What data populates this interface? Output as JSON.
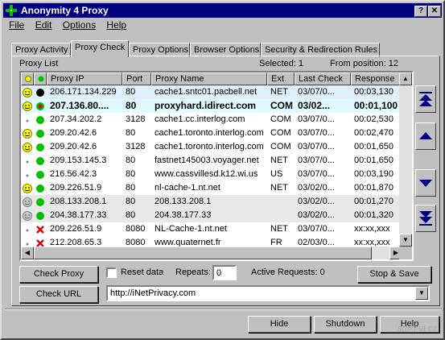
{
  "window": {
    "title": "Anonymity 4 Proxy"
  },
  "menu": [
    "File",
    "Edit",
    "Options",
    "Help"
  ],
  "tabs": [
    "Proxy Activity",
    "Proxy Check",
    "Proxy Options",
    "Browser Options",
    "Security & Redirection Rules"
  ],
  "active_tab": "Proxy Check",
  "list": {
    "label": "Proxy List",
    "selected_text": "Selected: 1",
    "from_position_text": "From position: 12",
    "columns": [
      "Proxy IP",
      "Port",
      "Proxy Name",
      "Ext.",
      "Last Check",
      "Response"
    ],
    "rows": [
      {
        "status": "smile",
        "dot": "black",
        "ip": "206.171.134.229",
        "port": "80",
        "name": "cache1.sntc01.pacbell.net",
        "ext": "NET",
        "last_check": "03/07/0...",
        "response": "00:03,130",
        "style": "sel"
      },
      {
        "status": "smile",
        "dot": "green-red",
        "ip": "207.136.80....",
        "port": "80",
        "name": "proxyhard.idirect.com",
        "ext": "COM",
        "last_check": "03/02...",
        "response": "00:01,100",
        "style": "bold"
      },
      {
        "status": "small",
        "dot": "green",
        "ip": "207.34.202.2",
        "port": "3128",
        "name": "cache1.cc.interlog.com",
        "ext": "COM",
        "last_check": "03/07/0...",
        "response": "00:02,530",
        "style": ""
      },
      {
        "status": "smile",
        "dot": "green",
        "ip": "209.20.42.6",
        "port": "80",
        "name": "cache1.toronto.interlog.com",
        "ext": "COM",
        "last_check": "03/07/0...",
        "response": "00:02,470",
        "style": ""
      },
      {
        "status": "smile",
        "dot": "green",
        "ip": "209.20.42.6",
        "port": "3128",
        "name": "cache1.toronto.interlog.com",
        "ext": "COM",
        "last_check": "03/07/0...",
        "response": "00:01,650",
        "style": ""
      },
      {
        "status": "small",
        "dot": "green",
        "ip": "209.153.145.3",
        "port": "80",
        "name": "fastnet145003.voyager.net",
        "ext": "NET",
        "last_check": "03/07/0...",
        "response": "00:01,650",
        "style": ""
      },
      {
        "status": "small",
        "dot": "green",
        "ip": "216.56.42.3",
        "port": "80",
        "name": "www.cassvillesd.k12.wi.us",
        "ext": "US",
        "last_check": "03/07/0...",
        "response": "00:03,190",
        "style": ""
      },
      {
        "status": "smile",
        "dot": "green",
        "ip": "209.226.51.9",
        "port": "80",
        "name": "nl-cache-1.nt.net",
        "ext": "NET",
        "last_check": "03/02/0...",
        "response": "00:01,870",
        "style": ""
      },
      {
        "status": "grey",
        "dot": "green",
        "ip": "208.133.208.1",
        "port": "80",
        "name": "208.133.208.1",
        "ext": "",
        "last_check": "03/02/0...",
        "response": "00:01,270",
        "style": "grey"
      },
      {
        "status": "grey",
        "dot": "green",
        "ip": "204.38.177.33",
        "port": "80",
        "name": "204.38.177.33",
        "ext": "",
        "last_check": "03/02/0...",
        "response": "00:01,320",
        "style": "grey"
      },
      {
        "status": "small",
        "dot": "x",
        "ip": "209.226.51.9",
        "port": "8080",
        "name": "NL-Cache-1.nt.net",
        "ext": "NET",
        "last_check": "03/07/0...",
        "response": "xx:xx,xxx",
        "style": ""
      },
      {
        "status": "small",
        "dot": "x",
        "ip": "212.208.65.3",
        "port": "8080",
        "name": "www.quaternet.fr",
        "ext": "FR",
        "last_check": "02/03/0...",
        "response": "xx:xx,xxx",
        "style": ""
      }
    ]
  },
  "controls": {
    "check_proxy": "Check Proxy",
    "reset_data": "Reset data",
    "repeats_label": "Repeats:",
    "repeats_value": "0",
    "active_requests": "Active Requests:  0",
    "stop_save": "Stop & Save",
    "check_url": "Check URL",
    "url_value": "http://iNetPrivacy.com"
  },
  "footer": {
    "hide": "Hide",
    "shutdown": "Shutdown",
    "help": "Help"
  },
  "watermark": "stuklna.cz",
  "colors": {
    "titlebar": "#000080",
    "face": "#c0c0c0",
    "selected_row": "#e0f0fa"
  }
}
